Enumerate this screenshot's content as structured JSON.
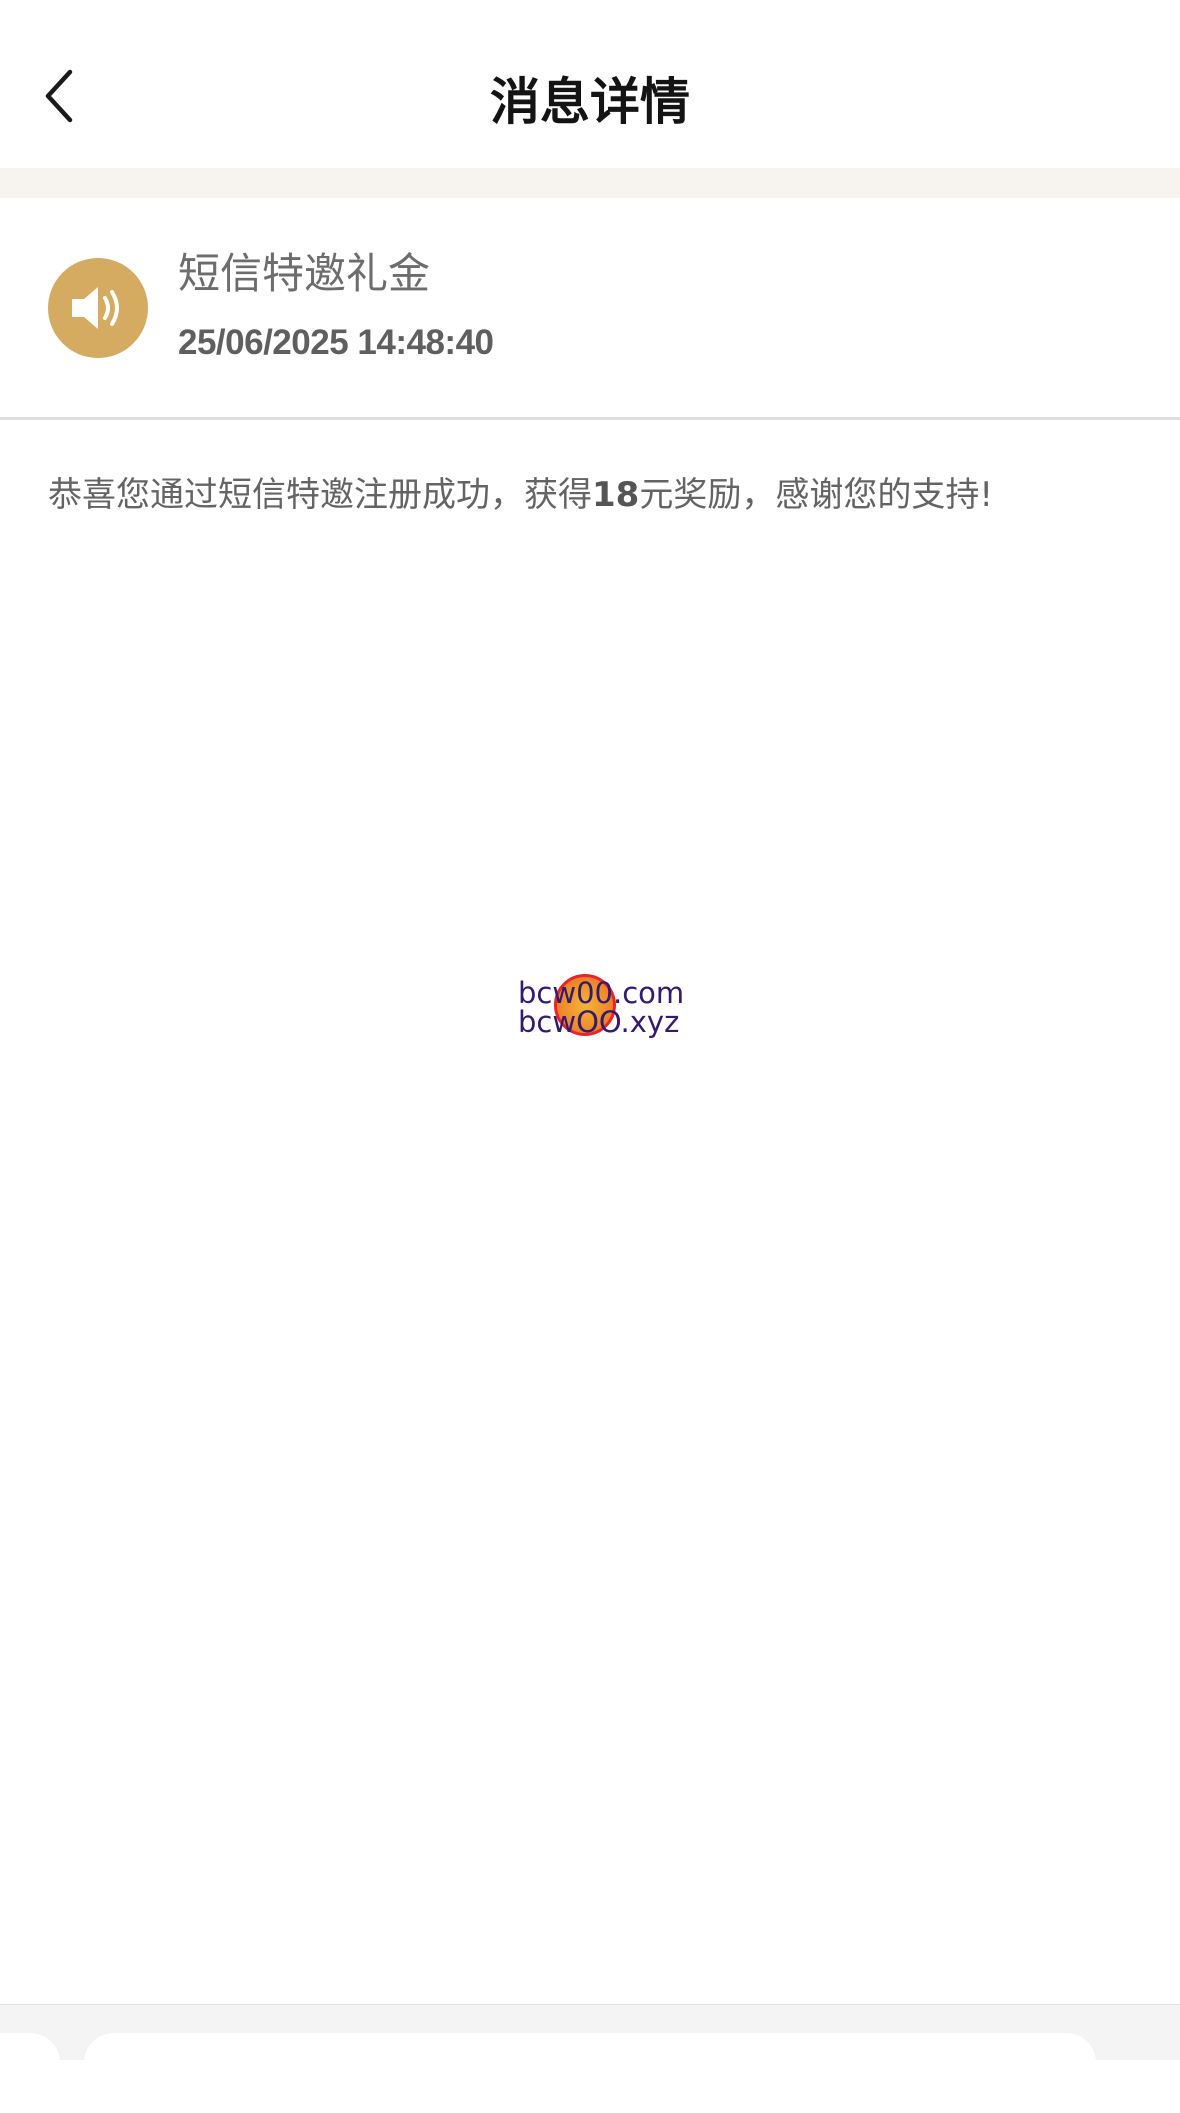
{
  "header": {
    "title": "消息详情",
    "back_icon": "chevron-left-icon"
  },
  "message": {
    "icon": "speaker-icon",
    "icon_color": "#d5ab62",
    "title": "短信特邀礼金",
    "timestamp": "25/06/2025 14:48:40",
    "body_prefix": "恭喜您通过短信特邀注册成功，获得",
    "body_amount": "18",
    "body_suffix": "元奖励，感谢您的支持!"
  },
  "watermark": {
    "line1": "bcw00.com",
    "line2": "bcwOO.xyz"
  }
}
